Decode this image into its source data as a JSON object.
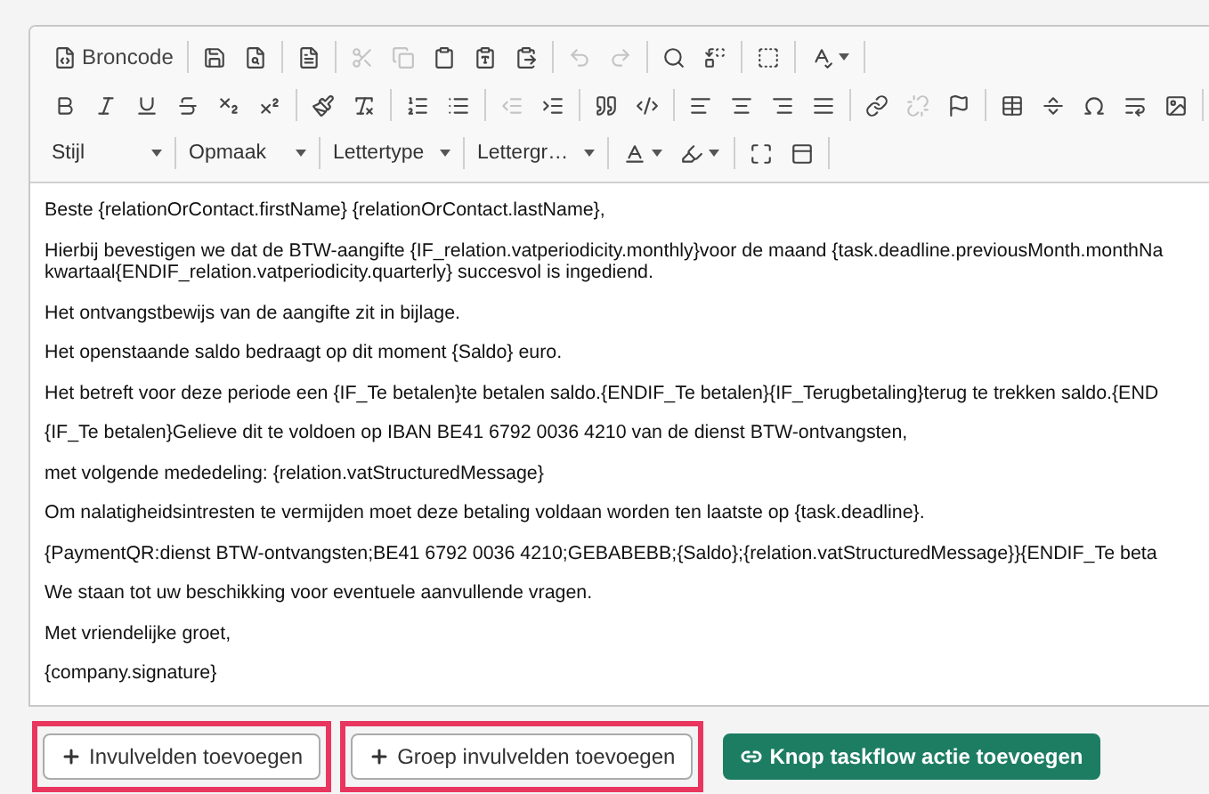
{
  "toolbar": {
    "rows": [
      [
        [
          {
            "kind": "source",
            "label": "Broncode",
            "disabled": false
          }
        ],
        [
          {
            "kind": "save",
            "disabled": false
          },
          {
            "kind": "preview",
            "disabled": false
          }
        ],
        [
          {
            "kind": "template",
            "disabled": false
          }
        ],
        [
          {
            "kind": "cut",
            "disabled": true
          },
          {
            "kind": "copy",
            "disabled": true
          },
          {
            "kind": "paste",
            "disabled": false
          },
          {
            "kind": "pastetext",
            "disabled": false
          },
          {
            "kind": "pasteword",
            "disabled": false
          }
        ],
        [
          {
            "kind": "undo",
            "disabled": true
          },
          {
            "kind": "redo",
            "disabled": true
          }
        ],
        [
          {
            "kind": "find",
            "disabled": false
          },
          {
            "kind": "replace",
            "disabled": false
          }
        ],
        [
          {
            "kind": "selectall",
            "disabled": false
          }
        ],
        [
          {
            "kind": "spellcheck",
            "disabled": false,
            "menu": true
          }
        ]
      ],
      [
        [
          {
            "kind": "bold",
            "disabled": false
          },
          {
            "kind": "italic",
            "disabled": false
          },
          {
            "kind": "underline",
            "disabled": false
          },
          {
            "kind": "strike",
            "disabled": false
          },
          {
            "kind": "subscript",
            "disabled": false
          },
          {
            "kind": "superscript",
            "disabled": false
          }
        ],
        [
          {
            "kind": "copyformat",
            "disabled": false
          },
          {
            "kind": "removeformat",
            "disabled": false
          }
        ],
        [
          {
            "kind": "numbered",
            "disabled": false
          },
          {
            "kind": "bulleted",
            "disabled": false
          }
        ],
        [
          {
            "kind": "outdent",
            "disabled": true
          },
          {
            "kind": "indent",
            "disabled": false
          }
        ],
        [
          {
            "kind": "blockquote",
            "disabled": false
          },
          {
            "kind": "div",
            "disabled": false
          }
        ],
        [
          {
            "kind": "alignleft",
            "disabled": false
          },
          {
            "kind": "aligncenter",
            "disabled": false
          },
          {
            "kind": "alignright",
            "disabled": false
          },
          {
            "kind": "justify",
            "disabled": false
          }
        ],
        [
          {
            "kind": "link",
            "disabled": false
          },
          {
            "kind": "unlink",
            "disabled": true
          },
          {
            "kind": "anchor",
            "disabled": false
          }
        ],
        [
          {
            "kind": "table",
            "disabled": false
          },
          {
            "kind": "rule",
            "disabled": false
          },
          {
            "kind": "specialchar",
            "disabled": false
          },
          {
            "kind": "pagebreak",
            "disabled": false
          },
          {
            "kind": "image",
            "disabled": false
          }
        ]
      ],
      [
        [
          {
            "kind": "combo",
            "label": "Stijl"
          }
        ],
        [
          {
            "kind": "combo",
            "label": "Opmaak"
          }
        ],
        [
          {
            "kind": "combo",
            "label": "Lettertype"
          }
        ],
        [
          {
            "kind": "combo",
            "label": "Lettergr…"
          }
        ],
        [
          {
            "kind": "textcolor",
            "disabled": false,
            "menu": true
          },
          {
            "kind": "bgcolor",
            "disabled": false,
            "menu": true
          }
        ],
        [
          {
            "kind": "maximize",
            "disabled": false
          },
          {
            "kind": "showblocks",
            "disabled": false
          }
        ]
      ]
    ]
  },
  "paragraphs": [
    "Beste {relationOrContact.firstName} {relationOrContact.lastName},",
    "Hierbij bevestigen we dat de BTW-aangifte {IF_relation.vatperiodicity.monthly}voor de maand {task.deadline.previousMonth.monthNa\nkwartaal{ENDIF_relation.vatperiodicity.quarterly} succesvol is ingediend.",
    "Het ontvangstbewijs van de aangifte zit in bijlage.",
    "Het openstaande saldo bedraagt op dit moment {Saldo} euro.",
    "Het betreft voor deze periode een {IF_Te betalen}te betalen saldo.{ENDIF_Te betalen}{IF_Terugbetaling}terug te trekken saldo.{END",
    "{IF_Te betalen}Gelieve dit te voldoen op IBAN BE41 6792 0036 4210 van de dienst BTW-ontvangsten,",
    "met volgende mededeling: {relation.vatStructuredMessage}",
    "Om nalatigheidsintresten te vermijden moet deze betaling voldaan worden ten laatste op {task.deadline}.",
    "{PaymentQR:dienst BTW-ontvangsten;BE41 6792 0036 4210;GEBABEBB;{Saldo};{relation.vatStructuredMessage}}{ENDIF_Te beta",
    "We staan tot uw beschikking voor eventuele aanvullende vragen.",
    "Met vriendelijke groet,",
    "{company.signature}"
  ],
  "buttons": [
    {
      "kind": "outline",
      "label": "Invulvelden toevoegen",
      "highlighted": true
    },
    {
      "kind": "outline",
      "label": "Groep invulvelden toevoegen",
      "highlighted": true
    },
    {
      "kind": "primary",
      "label": "Knop taskflow actie toevoegen",
      "highlighted": false
    }
  ]
}
